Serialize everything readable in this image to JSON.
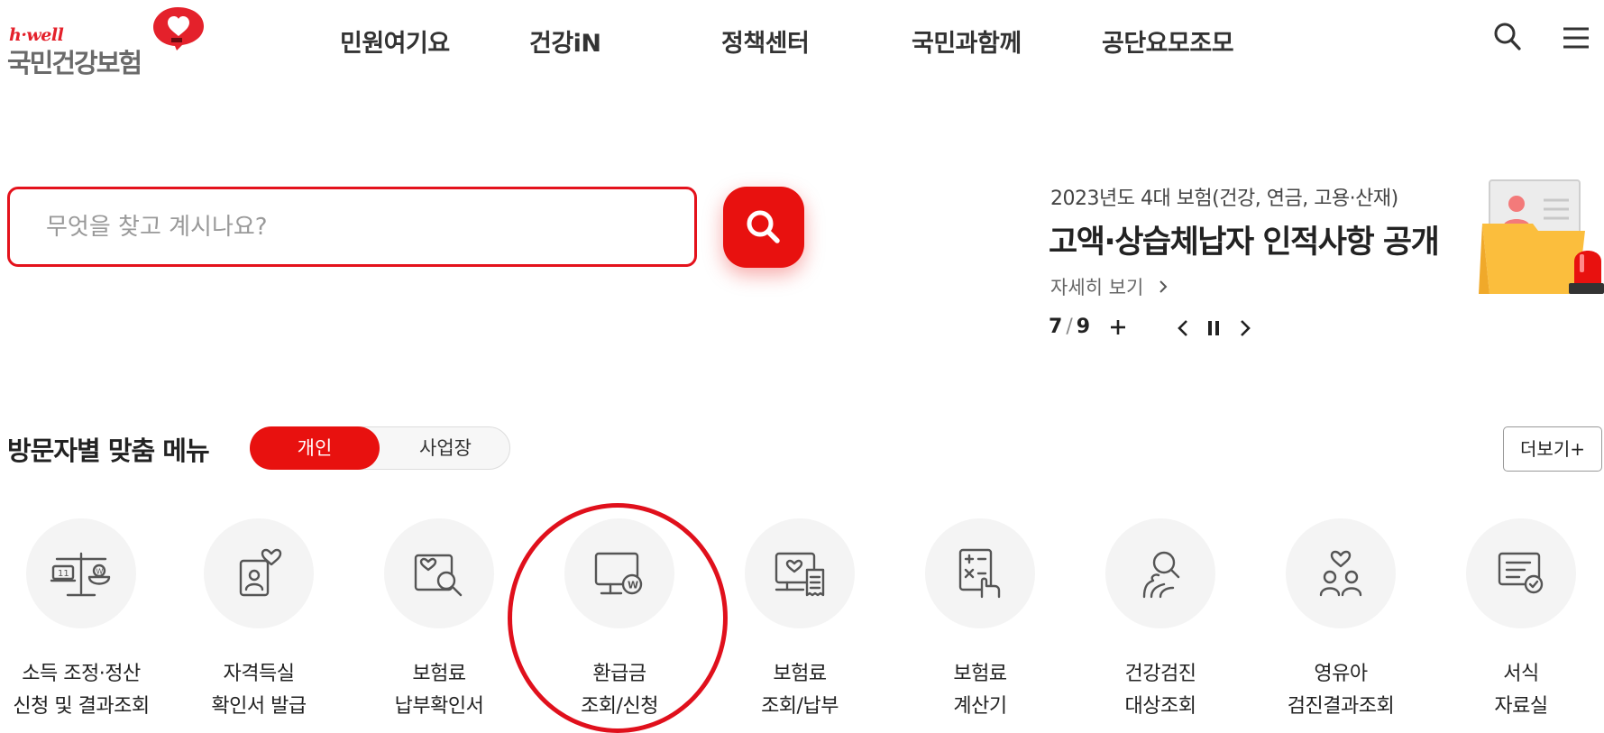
{
  "brand": {
    "tag": "h·well",
    "name": "국민건강보험",
    "accent": "#e8110f"
  },
  "gnb": [
    "민원여기요",
    "건강iN",
    "정책센터",
    "국민과함께",
    "공단요모조모"
  ],
  "header_icons": [
    "search-icon",
    "hamburger-menu-icon"
  ],
  "search": {
    "placeholder": "무엇을 찾고 계시나요?",
    "value": ""
  },
  "notice": {
    "subtitle": "2023년도 4대 보험(건강, 연금, 고용·산재)",
    "title": "고액·상습체납자 인적사항 공개",
    "more": "자세히 보기",
    "current": "7",
    "total": "9"
  },
  "visitor_menu": {
    "title": "방문자별 맞춤 메뉴",
    "tabs": {
      "personal": "개인",
      "business": "사업장"
    },
    "more": "더보기+",
    "items": [
      {
        "icon": "income-adjustment-icon",
        "line1": "소득 조정·정산",
        "line2": "신청 및 결과조회"
      },
      {
        "icon": "qualification-certificate-icon",
        "line1": "자격득실",
        "line2": "확인서 발급"
      },
      {
        "icon": "premium-payment-confirmation-icon",
        "line1": "보험료",
        "line2": "납부확인서"
      },
      {
        "icon": "refund-icon",
        "line1": "환급금",
        "line2": "조회/신청"
      },
      {
        "icon": "premium-inquiry-icon",
        "line1": "보험료",
        "line2": "조회/납부"
      },
      {
        "icon": "premium-calculator-icon",
        "line1": "보험료",
        "line2": "계산기"
      },
      {
        "icon": "health-checkup-icon",
        "line1": "건강검진",
        "line2": "대상조회"
      },
      {
        "icon": "infant-checkup-icon",
        "line1": "영유아",
        "line2": "검진결과조회"
      },
      {
        "icon": "forms-icon",
        "line1": "서식",
        "line2": "자료실"
      }
    ]
  }
}
